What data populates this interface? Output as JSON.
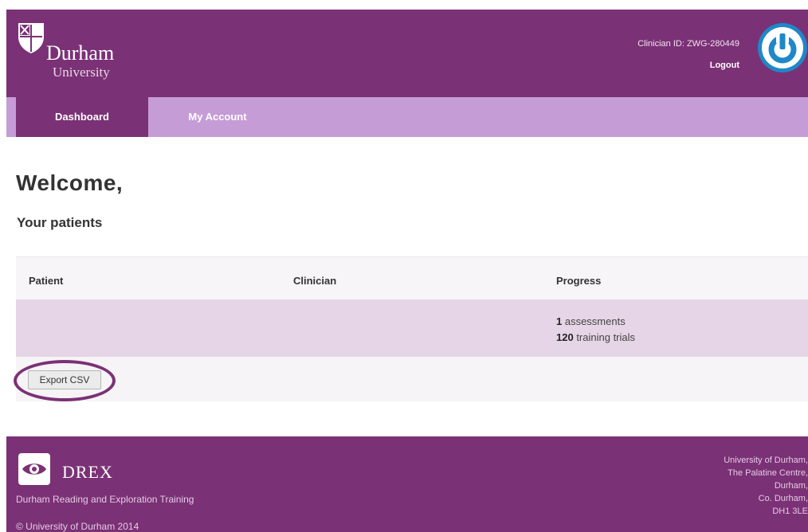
{
  "header": {
    "brand_name": "Durham",
    "brand_sub": "University",
    "clinician_id": "Clinician ID: ZWG-280449",
    "logout_label": "Logout"
  },
  "nav": {
    "tabs": [
      {
        "label": "Dashboard",
        "active": true
      },
      {
        "label": "My Account",
        "active": false
      }
    ]
  },
  "main": {
    "welcome": "Welcome,",
    "subtitle": "Your patients",
    "table": {
      "columns": [
        "Patient",
        "Clinician",
        "Progress"
      ],
      "rows": [
        {
          "patient": "",
          "clinician": "",
          "assessments_count": "1",
          "assessments_label": " assessments",
          "trials_count": "120",
          "trials_label": " training trials"
        }
      ]
    },
    "export_label": "Export CSV"
  },
  "footer": {
    "app_name": "DREX",
    "app_tagline": "Durham Reading and Exploration Training",
    "copyright": "© University of Durham 2014",
    "address": [
      "University of Durham,",
      "The Palatine Centre,",
      "Durham,",
      "Co. Durham,",
      "DH1 3LE"
    ]
  },
  "colors": {
    "primary_purple": "#7b3176",
    "nav_lilac": "#c59cd6",
    "row_highlight": "#e6d5e6",
    "badge_blue": "#1e88c8"
  },
  "icons": {
    "university_crest": "shield-icon",
    "user_badge": "power-icon",
    "drex_logo": "eye-icon"
  }
}
